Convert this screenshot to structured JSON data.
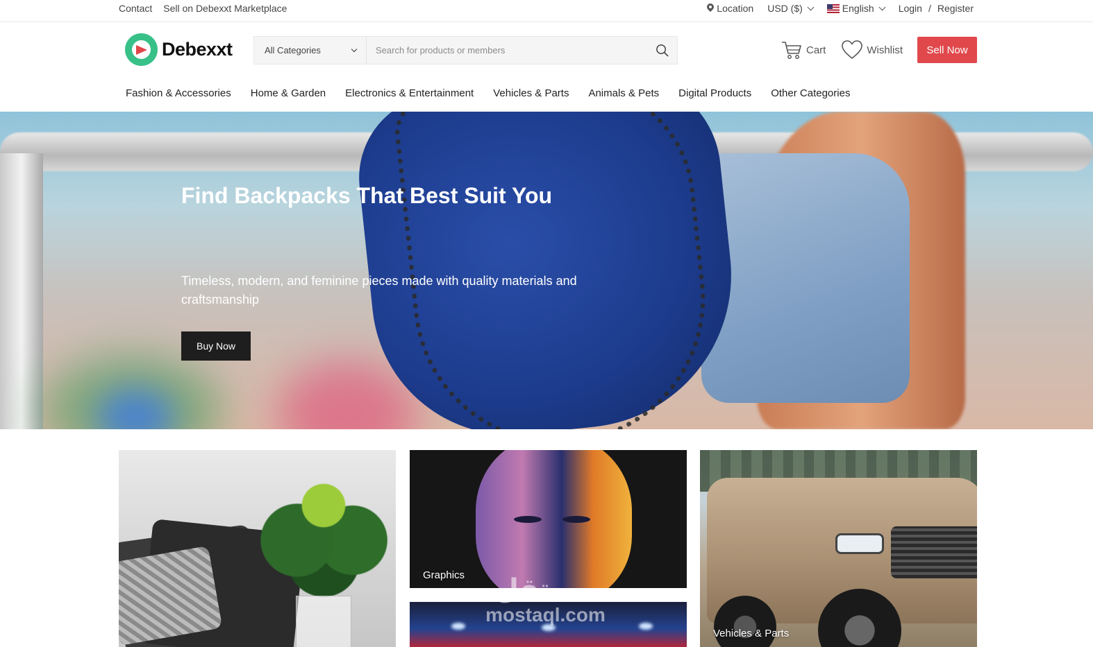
{
  "topbar": {
    "contact": "Contact",
    "sell_on": "Sell on Debexxt Marketplace",
    "location": "Location",
    "currency": "USD ($)",
    "language": "English",
    "login": "Login",
    "separator": "/",
    "register": "Register"
  },
  "header": {
    "logo_text": "Debexxt",
    "search_category": "All Categories",
    "search_placeholder": "Search for products or members",
    "cart": "Cart",
    "wishlist": "Wishlist",
    "sell_now": "Sell Now"
  },
  "categories": [
    "Fashion & Accessories",
    "Home & Garden",
    "Electronics & Entertainment",
    "Vehicles & Parts",
    "Animals & Pets",
    "Digital Products",
    "Other Categories"
  ],
  "hero": {
    "title": "Find Backpacks That Best Suit You",
    "subtitle": "Timeless, modern, and feminine pieces made with quality materials and craftsmanship",
    "button": "Buy Now"
  },
  "tiles": {
    "graphics": "Graphics",
    "vehicles": "Vehicles & Parts"
  },
  "watermark": {
    "arabic": "مستقل",
    "latin": "mostaql.com"
  },
  "colors": {
    "accent": "#e0484c",
    "logo_green": "#37c088",
    "dark_button": "#1e1e1e"
  }
}
